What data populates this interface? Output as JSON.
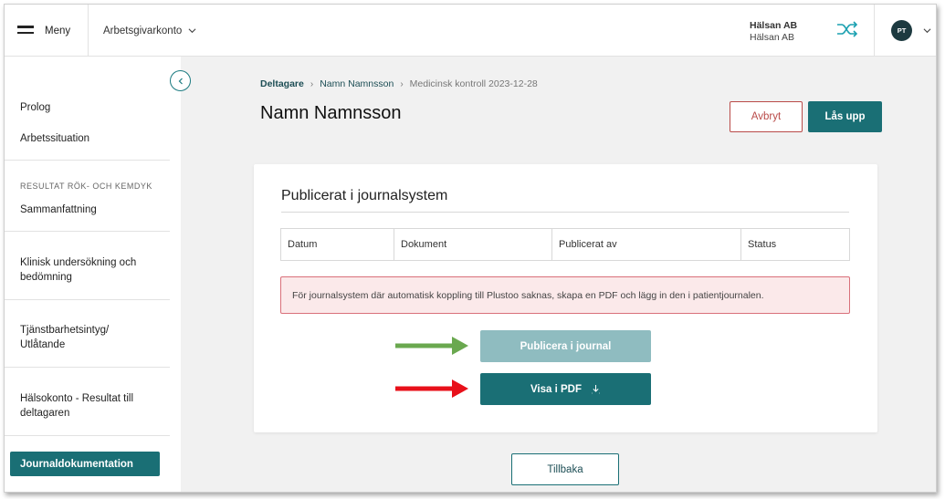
{
  "header": {
    "menu_label": "Meny",
    "account_select": "Arbetsgivarkonto",
    "org_name": "Hälsan AB",
    "org_sub": "Hälsan AB",
    "user_initials": "PT"
  },
  "sidebar": {
    "items": [
      {
        "label": "Prolog"
      },
      {
        "label": "Arbetssituation"
      },
      {
        "label": "Sammanfattning"
      },
      {
        "label": "Klinisk undersökning och bedömning"
      },
      {
        "label": "Tjänstbarhetsintyg/ Utlåtande"
      },
      {
        "label": "Hälsokonto - Resultat till deltagaren"
      },
      {
        "label": "Journaldokumentation"
      }
    ],
    "section_heading": "RESULTAT RÖK- OCH KEMDYK"
  },
  "breadcrumb": {
    "items": [
      "Deltagare",
      "Namn Namnsson",
      "Medicinsk kontroll 2023-12-28"
    ]
  },
  "page": {
    "title": "Namn Namnsson",
    "cancel_label": "Avbryt",
    "unlock_label": "Lås upp",
    "back_label": "Tillbaka"
  },
  "card": {
    "title": "Publicerat i journalsystem",
    "columns": [
      "Datum",
      "Dokument",
      "Publicerat av",
      "Status"
    ],
    "alert": "För journalsystem där automatisk koppling till Plustoo saknas, skapa en PDF och lägg in den i patientjournalen.",
    "publish_label": "Publicera i journal",
    "pdf_label": "Visa i PDF"
  },
  "colors": {
    "primary": "#1a6f75",
    "primary_disabled": "#8fbcc0",
    "danger": "#b94a48",
    "alert_bg": "#fbe9ea",
    "annotation_green": "#6aa84f",
    "annotation_red": "#e8101a"
  }
}
